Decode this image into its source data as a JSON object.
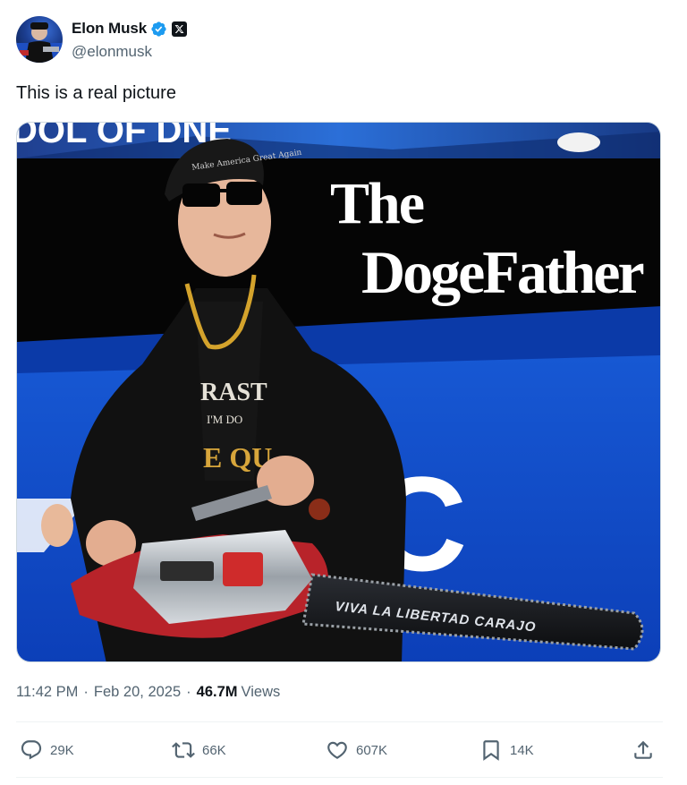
{
  "post": {
    "author": {
      "display_name": "Elon Musk",
      "handle": "@elonmusk",
      "verified_icon": "verified-badge-icon",
      "affiliation_icon": "x-logo-icon"
    },
    "text": "This is a real picture",
    "media": {
      "banner_line_1": "The",
      "banner_line_2": "DogeFather",
      "chainsaw_bar_text": "VIVA LA LIBERTAD CARAJO",
      "top_sign_fragment": "DOL OF DNE",
      "large_letter": "C",
      "hat_text": "Make America Great Again",
      "shirt_line_1": "RAST",
      "shirt_line_2": "I'M DO",
      "shirt_line_3": "E QU"
    },
    "meta": {
      "time": "11:42 PM",
      "sep1": "·",
      "date": "Feb 20, 2025",
      "sep2": "·",
      "views_count": "46.7M",
      "views_label": "Views"
    },
    "actions": {
      "replies": "29K",
      "reposts": "66K",
      "likes": "607K",
      "bookmarks": "14K"
    },
    "colors": {
      "text_primary": "#0f1419",
      "text_secondary": "#536471",
      "verified_blue": "#1d9bf0",
      "divider": "#eff3f4"
    }
  }
}
